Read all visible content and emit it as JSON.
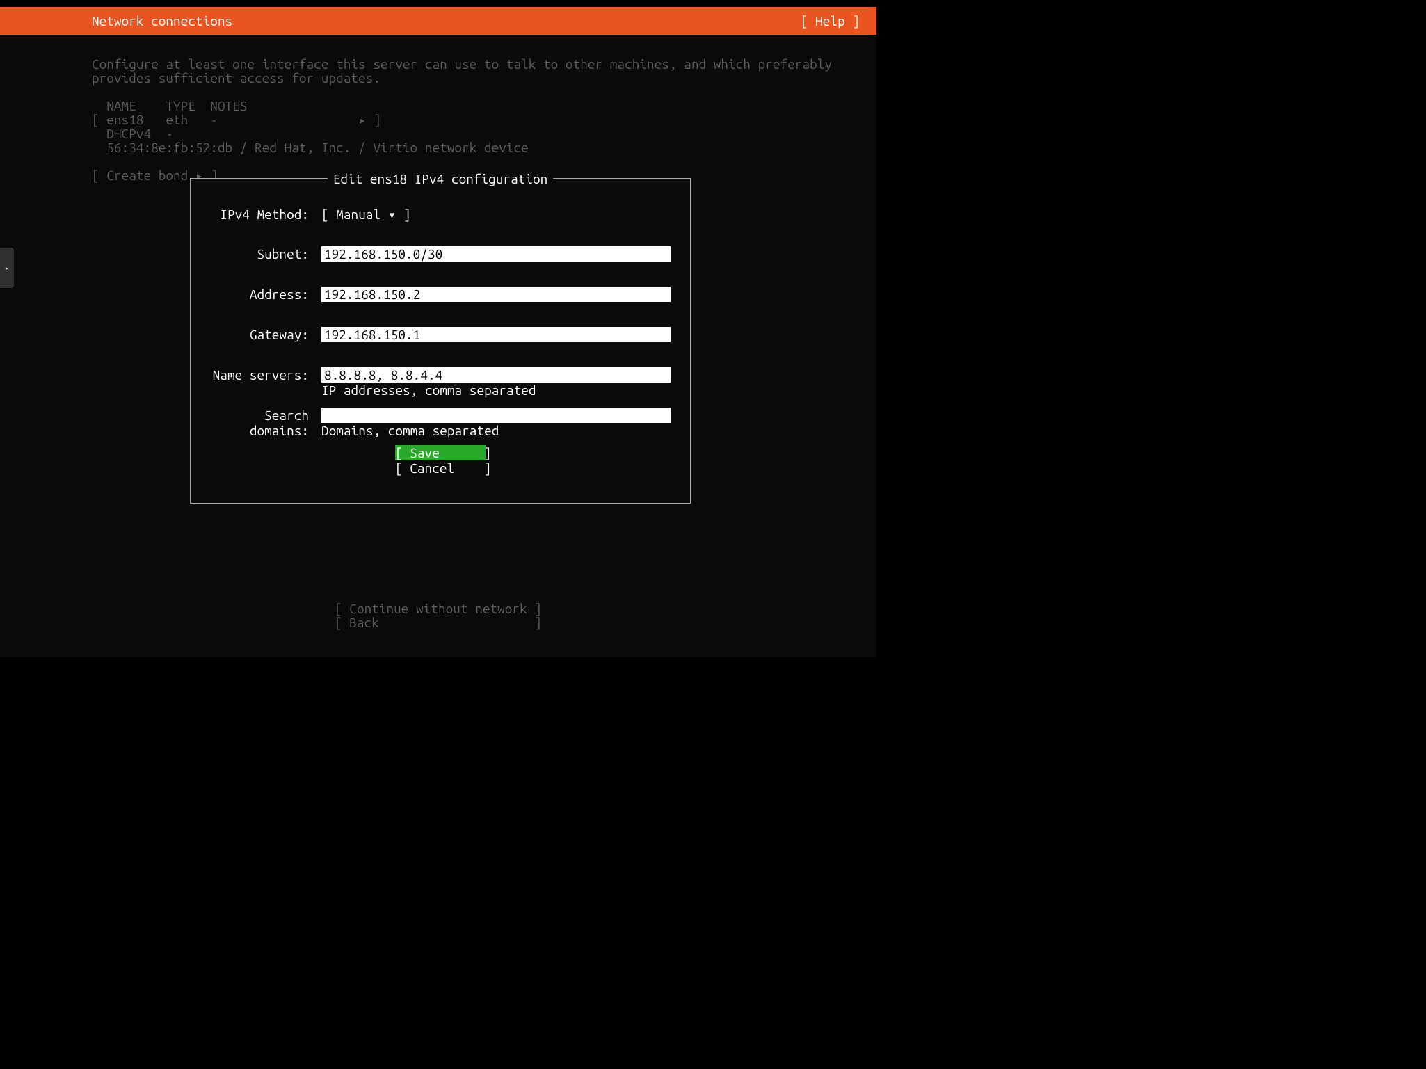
{
  "header": {
    "title": "Network connections",
    "help": "[ Help ]"
  },
  "description": "Configure at least one interface this server can use to talk to other machines, and which preferably\nprovides sufficient access for updates.",
  "iface_table": {
    "headers": "  NAME    TYPE  NOTES",
    "row": "[ ens18   eth   -                   ▸ ]",
    "dhcp": "  DHCPv4  -",
    "mac": "  56:34:8e:fb:52:db / Red Hat, Inc. / Virtio network device"
  },
  "create_bond": "[ Create bond ▸ ]",
  "modal": {
    "title": "Edit ens18 IPv4 configuration",
    "method_label": "IPv4 Method:",
    "method_value": "[ Manual           ▾ ]",
    "fields": {
      "subnet": {
        "label": "Subnet:",
        "value": "192.168.150.0/30"
      },
      "address": {
        "label": "Address:",
        "value": "192.168.150.2"
      },
      "gateway": {
        "label": "Gateway:",
        "value": "192.168.150.1"
      },
      "dns": {
        "label": "Name servers:",
        "value": "8.8.8.8, 8.8.4.4",
        "hint": "IP addresses, comma separated"
      },
      "search": {
        "label": "Search domains:",
        "value": "",
        "hint": "Domains, comma separated"
      }
    },
    "save": "[ Save      ]",
    "cancel": "[ Cancel    ]"
  },
  "footer": {
    "continue": "[ Continue without network ]",
    "back": "[ Back                     ]"
  },
  "drawer_glyph": "▸"
}
